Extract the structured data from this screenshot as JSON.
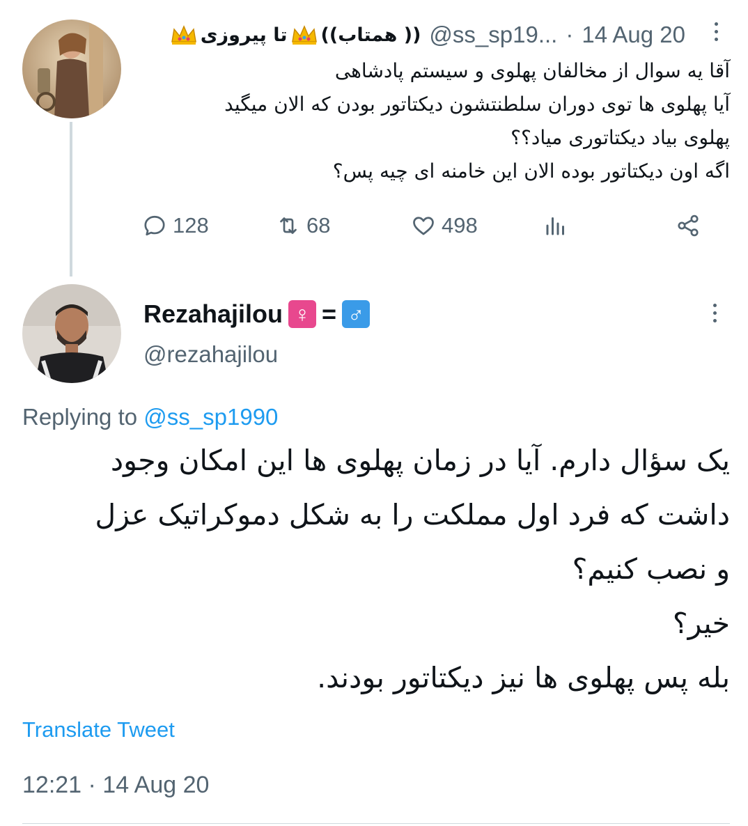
{
  "parent_tweet": {
    "author_name": "((همتاب )) تا پیروزی",
    "author_name_parts": [
      "تا پیروزی",
      "((همتاب ))"
    ],
    "handle": "@ss_sp19...",
    "date": "14 Aug 20",
    "separator": "·",
    "text_lines": [
      "آقا یه سوال از مخالفان پهلوی و سیستم پادشاهی",
      "آیا پهلوی ها توی دوران سلطنتشون دیکتاتور بودن که الان میگید",
      "پهلوی بیاد دیکتاتوری میاد؟؟",
      "اگه اون دیکتاتور بوده الان این خامنه ای چیه پس؟"
    ],
    "actions": {
      "replies": "128",
      "retweets": "68",
      "likes": "498"
    }
  },
  "main_tweet": {
    "author_name": "Rezahajilou",
    "author_emoji": [
      "♀",
      "=",
      "♂"
    ],
    "handle": "@rezahajilou",
    "replying_label": "Replying to",
    "replying_to": "@ss_sp1990",
    "text_lines": [
      "یک سؤال دارم. آیا در زمان پهلوی ها این امکان وجود",
      "داشت که فرد اول مملکت را به شکل دموکراتیک عزل",
      "و نصب کنیم؟",
      "خیر؟",
      "بله پس پهلوی ها نیز دیکتاتور بودند."
    ],
    "translate_label": "Translate Tweet",
    "timestamp": "12:21 · 14 Aug 20"
  },
  "icons": [
    "more-icon",
    "reply-icon",
    "retweet-icon",
    "like-icon",
    "analytics-icon",
    "share-icon",
    "crown-icon"
  ],
  "colors": {
    "link": "#1d9bf0",
    "secondary_text": "#536471",
    "primary_text": "#0f1419",
    "divider": "#cfd9de"
  }
}
